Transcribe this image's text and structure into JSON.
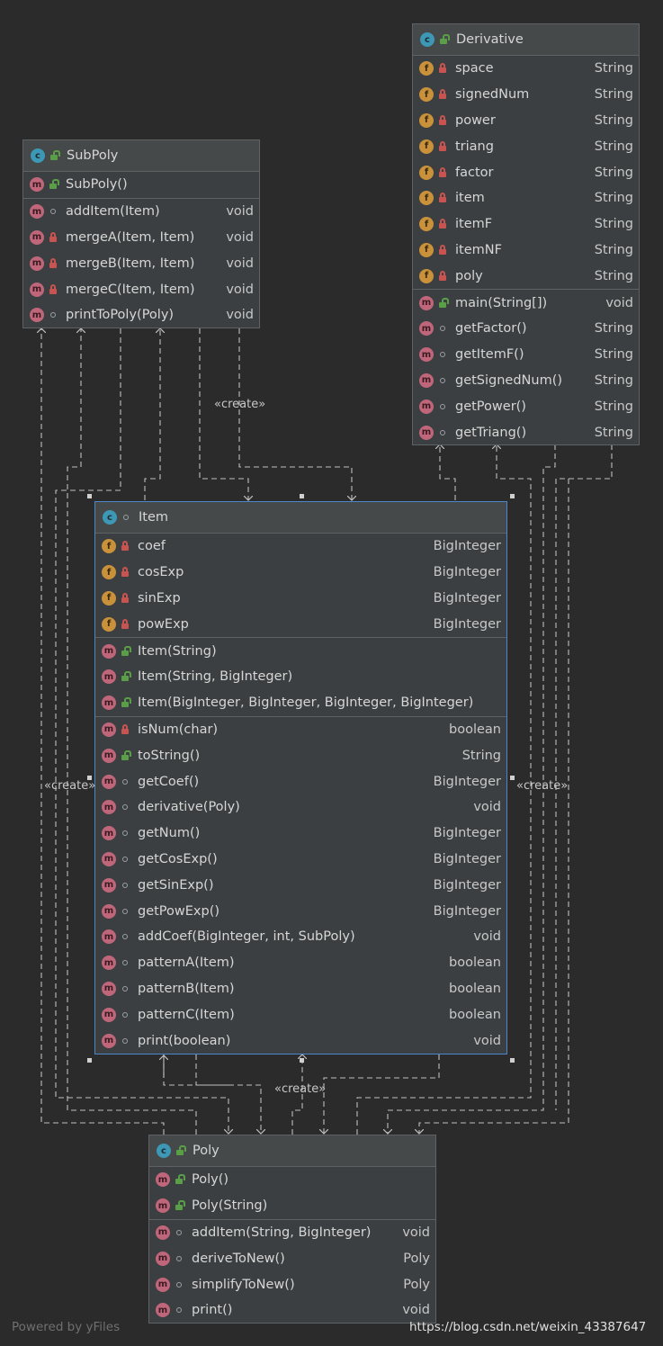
{
  "colors": {
    "background": "#2b2b2b",
    "node_bg": "#3c3f41",
    "edge": "#bfbfbf",
    "selection": "#4a88c7"
  },
  "nodes": {
    "derivative": {
      "title": "Derivative",
      "icon": "class-icon",
      "sections": [
        [
          {
            "kind": "f",
            "vis": "private",
            "name": "space",
            "type": "String"
          },
          {
            "kind": "f",
            "vis": "private",
            "name": "signedNum",
            "type": "String"
          },
          {
            "kind": "f",
            "vis": "private",
            "name": "power",
            "type": "String"
          },
          {
            "kind": "f",
            "vis": "private",
            "name": "triang",
            "type": "String"
          },
          {
            "kind": "f",
            "vis": "private",
            "name": "factor",
            "type": "String"
          },
          {
            "kind": "f",
            "vis": "private",
            "name": "item",
            "type": "String"
          },
          {
            "kind": "f",
            "vis": "private",
            "name": "itemF",
            "type": "String"
          },
          {
            "kind": "f",
            "vis": "private",
            "name": "itemNF",
            "type": "String"
          },
          {
            "kind": "f",
            "vis": "private",
            "name": "poly",
            "type": "String"
          }
        ],
        [
          {
            "kind": "m",
            "vis": "public",
            "name": "main(String[])",
            "type": "void"
          },
          {
            "kind": "m",
            "vis": "package",
            "name": "getFactor()",
            "type": "String"
          },
          {
            "kind": "m",
            "vis": "package",
            "name": "getItemF()",
            "type": "String"
          },
          {
            "kind": "m",
            "vis": "package",
            "name": "getSignedNum()",
            "type": "String"
          },
          {
            "kind": "m",
            "vis": "package",
            "name": "getPower()",
            "type": "String"
          },
          {
            "kind": "m",
            "vis": "package",
            "name": "getTriang()",
            "type": "String"
          }
        ]
      ]
    },
    "subpoly": {
      "title": "SubPoly",
      "icon": "class-icon",
      "sections": [
        [
          {
            "kind": "m",
            "vis": "public",
            "name": "SubPoly()",
            "type": ""
          }
        ],
        [
          {
            "kind": "m",
            "vis": "package",
            "name": "addItem(Item)",
            "type": "void"
          },
          {
            "kind": "m",
            "vis": "private",
            "name": "mergeA(Item, Item)",
            "type": "void"
          },
          {
            "kind": "m",
            "vis": "private",
            "name": "mergeB(Item, Item)",
            "type": "void"
          },
          {
            "kind": "m",
            "vis": "private",
            "name": "mergeC(Item, Item)",
            "type": "void"
          },
          {
            "kind": "m",
            "vis": "package",
            "name": "printToPoly(Poly)",
            "type": "void"
          }
        ]
      ]
    },
    "item": {
      "title": "Item",
      "icon": "class-icon",
      "sections": [
        [
          {
            "kind": "f",
            "vis": "private",
            "name": "coef",
            "type": "BigInteger"
          },
          {
            "kind": "f",
            "vis": "private",
            "name": "cosExp",
            "type": "BigInteger"
          },
          {
            "kind": "f",
            "vis": "private",
            "name": "sinExp",
            "type": "BigInteger"
          },
          {
            "kind": "f",
            "vis": "private",
            "name": "powExp",
            "type": "BigInteger"
          }
        ],
        [
          {
            "kind": "m",
            "vis": "public",
            "name": "Item(String)",
            "type": ""
          },
          {
            "kind": "m",
            "vis": "public",
            "name": "Item(String, BigInteger)",
            "type": ""
          },
          {
            "kind": "m",
            "vis": "public",
            "name": "Item(BigInteger, BigInteger, BigInteger, BigInteger)",
            "type": ""
          }
        ],
        [
          {
            "kind": "m",
            "vis": "private",
            "name": "isNum(char)",
            "type": "boolean"
          },
          {
            "kind": "m",
            "vis": "public",
            "name": "toString()",
            "type": "String"
          },
          {
            "kind": "m",
            "vis": "package",
            "name": "getCoef()",
            "type": "BigInteger"
          },
          {
            "kind": "m",
            "vis": "package",
            "name": "derivative(Poly)",
            "type": "void"
          },
          {
            "kind": "m",
            "vis": "package",
            "name": "getNum()",
            "type": "BigInteger"
          },
          {
            "kind": "m",
            "vis": "package",
            "name": "getCosExp()",
            "type": "BigInteger"
          },
          {
            "kind": "m",
            "vis": "package",
            "name": "getSinExp()",
            "type": "BigInteger"
          },
          {
            "kind": "m",
            "vis": "package",
            "name": "getPowExp()",
            "type": "BigInteger"
          },
          {
            "kind": "m",
            "vis": "package",
            "name": "addCoef(BigInteger, int, SubPoly)",
            "type": "void"
          },
          {
            "kind": "m",
            "vis": "package",
            "name": "patternA(Item)",
            "type": "boolean"
          },
          {
            "kind": "m",
            "vis": "package",
            "name": "patternB(Item)",
            "type": "boolean"
          },
          {
            "kind": "m",
            "vis": "package",
            "name": "patternC(Item)",
            "type": "boolean"
          },
          {
            "kind": "m",
            "vis": "package",
            "name": "print(boolean)",
            "type": "void"
          }
        ]
      ]
    },
    "poly": {
      "title": "Poly",
      "icon": "class-icon",
      "sections": [
        [
          {
            "kind": "m",
            "vis": "public",
            "name": "Poly()",
            "type": ""
          },
          {
            "kind": "m",
            "vis": "public",
            "name": "Poly(String)",
            "type": ""
          }
        ],
        [
          {
            "kind": "m",
            "vis": "package",
            "name": "addItem(String, BigInteger)",
            "type": "void"
          },
          {
            "kind": "m",
            "vis": "package",
            "name": "deriveToNew()",
            "type": "Poly"
          },
          {
            "kind": "m",
            "vis": "package",
            "name": "simplifyToNew()",
            "type": "Poly"
          },
          {
            "kind": "m",
            "vis": "package",
            "name": "print()",
            "type": "void"
          }
        ]
      ]
    }
  },
  "labels": {
    "create_top": "«create»",
    "create_left": "«create»",
    "create_right": "«create»",
    "create_bottom": "«create»"
  },
  "footer": {
    "powered_by": "Powered by yFiles",
    "watermark": "https://blog.csdn.net/weixin_43387647"
  }
}
